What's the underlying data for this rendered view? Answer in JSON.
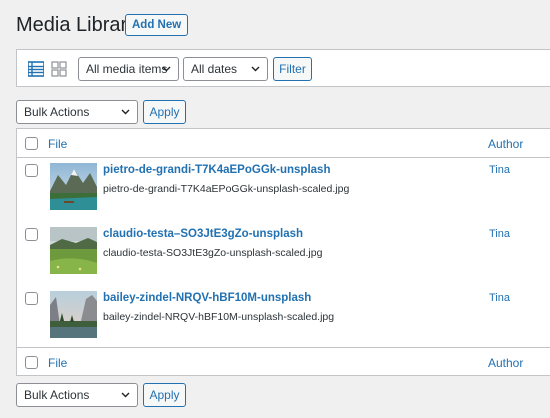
{
  "header": {
    "title": "Media Library",
    "add_new": "Add New"
  },
  "filters": {
    "view_list_icon": "list-view-icon",
    "view_grid_icon": "grid-view-icon",
    "media_type": "All media items",
    "dates": "All dates",
    "filter_label": "Filter"
  },
  "bulk": {
    "label": "Bulk Actions",
    "apply": "Apply"
  },
  "table": {
    "columns": {
      "file": "File",
      "author": "Author"
    },
    "rows": [
      {
        "title": "pietro-de-grandi-T7K4aEPoGGk-unsplash",
        "filename": "pietro-de-grandi-T7K4aEPoGGk-unsplash-scaled.jpg",
        "author": "Tina"
      },
      {
        "title": "claudio-testa–SO3JtE3gZo-unsplash",
        "filename": "claudio-testa-SO3JtE3gZo-unsplash-scaled.jpg",
        "author": "Tina"
      },
      {
        "title": "bailey-zindel-NRQV-hBF10M-unsplash",
        "filename": "bailey-zindel-NRQV-hBF10M-unsplash-scaled.jpg",
        "author": "Tina"
      }
    ]
  },
  "colors": {
    "accent": "#2271b1",
    "background": "#f0f0f1",
    "border": "#c3c4c7"
  }
}
